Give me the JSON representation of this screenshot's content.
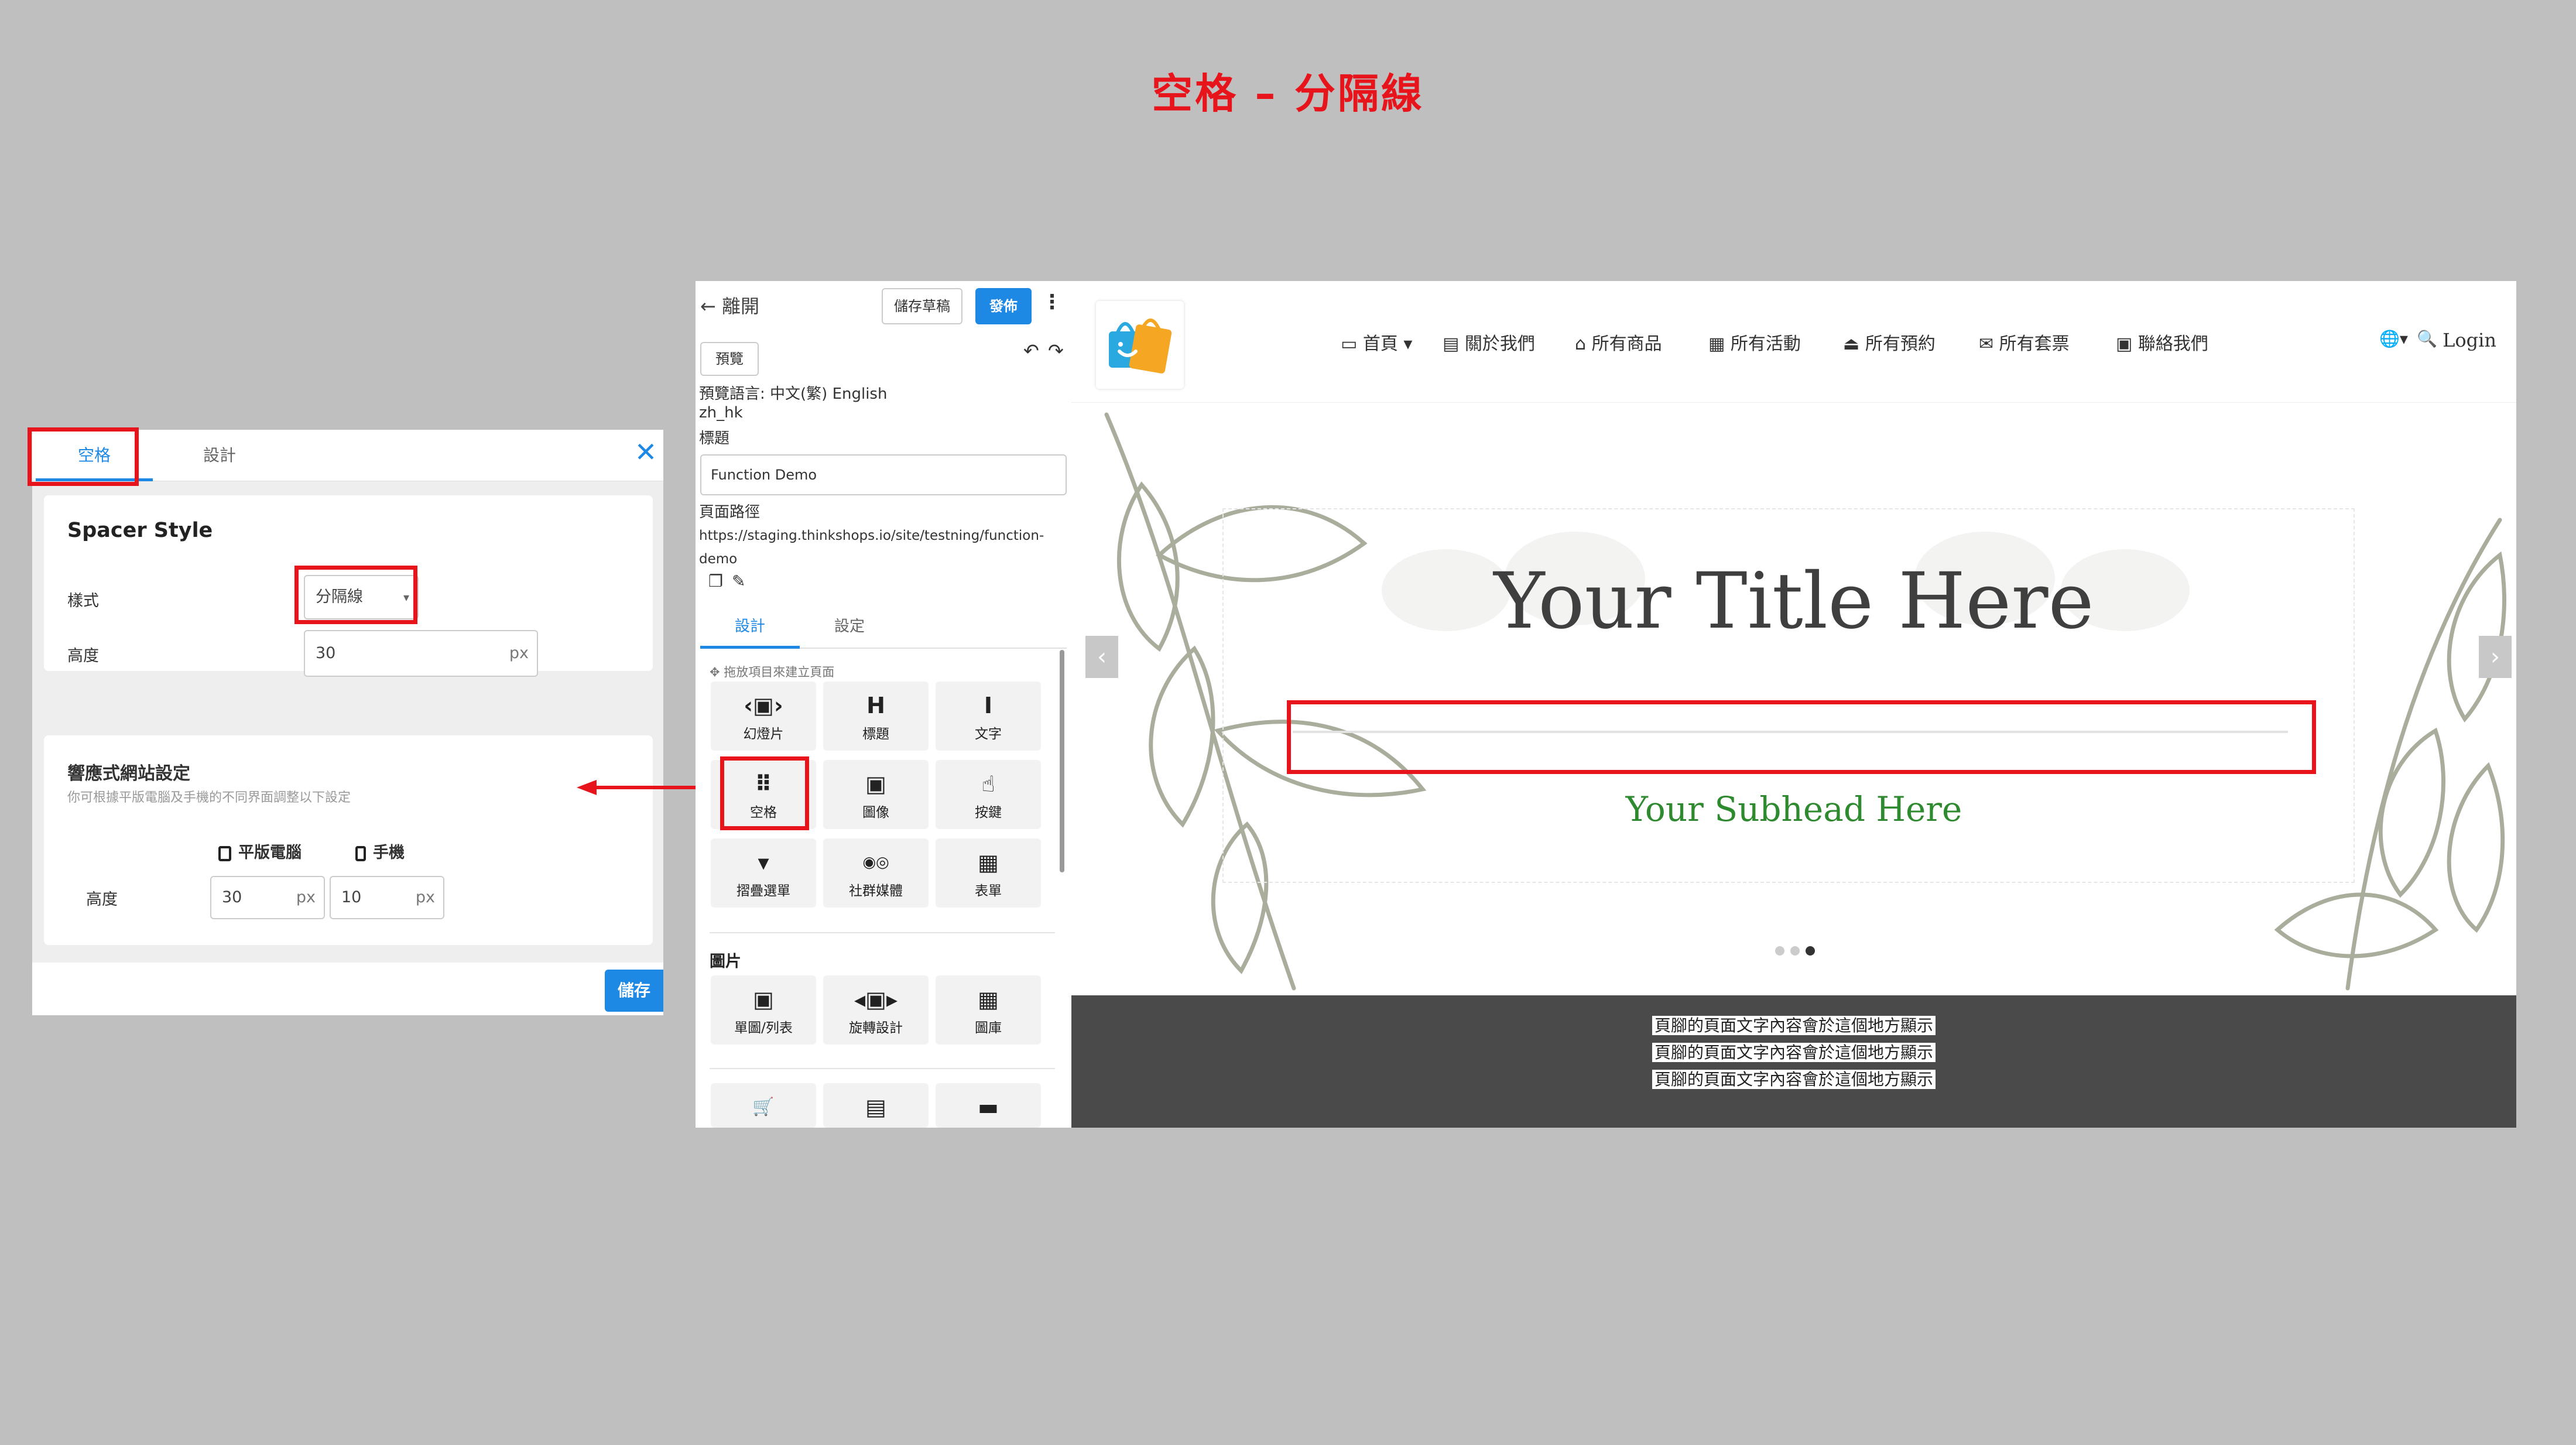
{
  "slide_title": "空格 – 分隔線",
  "settings_panel": {
    "tabs": [
      "空格",
      "設計"
    ],
    "spacer_style_title": "Spacer Style",
    "style_label": "樣式",
    "style_value": "分隔線",
    "height_label": "高度",
    "height_value": "30",
    "unit": "px",
    "responsive_title": "響應式網站設定",
    "responsive_desc": "你可根據平版電腦及手機的不同界面調整以下設定",
    "tablet_label": "平版電腦",
    "mobile_label": "手機",
    "resp_height_label": "高度",
    "tablet_height": "30",
    "mobile_height": "10",
    "save_label": "儲存"
  },
  "editor": {
    "leave_label": "← 離開",
    "save_draft_label": "儲存草稿",
    "publish_label": "發佈",
    "preview_label": "預覽",
    "preview_language_line": "預覽語言: 中文(繁) English",
    "locale": "zh_hk",
    "title_label": "標題",
    "title_value": "Function Demo",
    "path_label": "頁面路徑",
    "path_line1": "https://staging.thinkshops.io/site/testning/function-",
    "path_line2": "demo",
    "tabs": [
      "設計",
      "設定"
    ],
    "drag_hint": "✥ 拖放項目來建立頁面",
    "components": [
      {
        "icon": "‹▣›",
        "label": "幻燈片"
      },
      {
        "icon": "H",
        "label": "標題"
      },
      {
        "icon": "I",
        "label": "文字"
      },
      {
        "icon": "⠿",
        "label": "空格"
      },
      {
        "icon": "▣",
        "label": "圖像"
      },
      {
        "icon": "☝",
        "label": "按鍵"
      },
      {
        "icon": "▾",
        "label": "摺疊選單"
      },
      {
        "icon": "◉◎",
        "label": "社群媒體"
      },
      {
        "icon": "▦",
        "label": "表單"
      }
    ],
    "images_heading": "圖片",
    "image_components": [
      {
        "icon": "▣",
        "label": "單圖/列表"
      },
      {
        "icon": "◂▣▸",
        "label": "旋轉設計"
      },
      {
        "icon": "▦",
        "label": "圖庫"
      }
    ],
    "more_icons": [
      "🛒",
      "▤",
      "▬"
    ]
  },
  "site": {
    "nav": [
      "▭ 首頁 ▾",
      "▤ 關於我們",
      "⌂ 所有商品",
      "▦ 所有活動",
      "⏏ 所有預約",
      "✉ 所有套票",
      "▣ 聯絡我們"
    ],
    "globe_label": "🌐▾",
    "search_label": "🔍",
    "login_label": "Login",
    "hero_title": "Your Title Here",
    "hero_subhead": "Your Subhead Here",
    "footer_lines": [
      "頁腳的頁面文字內容會於這個地方顯示",
      "頁腳的頁面文字內容會於這個地方顯示",
      "頁腳的頁面文字內容會於這個地方顯示"
    ]
  },
  "colors": {
    "highlight": "#e8141b",
    "primary": "#1e88e5",
    "subhead": "#2e8a2e"
  }
}
